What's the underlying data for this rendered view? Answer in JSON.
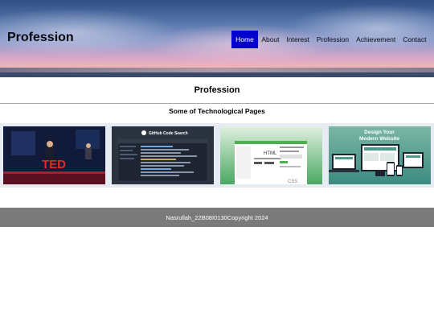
{
  "header": {
    "brand": "Profession",
    "nav": [
      {
        "label": "Home",
        "active": true
      },
      {
        "label": "About",
        "active": false
      },
      {
        "label": "Interest",
        "active": false
      },
      {
        "label": "Profession",
        "active": false
      },
      {
        "label": "Achievement",
        "active": false
      },
      {
        "label": "Contact",
        "active": false
      }
    ]
  },
  "main": {
    "title": "Profession",
    "subtitle": "Some of Technological Pages",
    "gallery": [
      {
        "name": "ted-talk-image",
        "text": "TED"
      },
      {
        "name": "github-code-search-image",
        "text": "GitHub Code Search"
      },
      {
        "name": "html-css-image",
        "text_html": "HTML",
        "text_css": "CSS"
      },
      {
        "name": "design-website-image",
        "text_line1": "Design Your",
        "text_line2": "Modern Website"
      }
    ]
  },
  "footer": {
    "text": "Nasrullah_22B08I0130Copyright 2024"
  },
  "colors": {
    "nav_active_bg": "#0000cc",
    "footer_bg": "#7a7a7a"
  }
}
